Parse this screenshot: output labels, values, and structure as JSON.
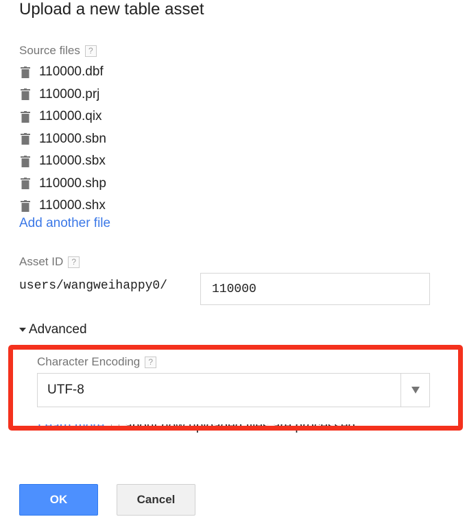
{
  "dialog": {
    "title": "Upload a new table asset"
  },
  "source_files": {
    "label": "Source files",
    "help": "?",
    "files": [
      "110000.dbf",
      "110000.prj",
      "110000.qix",
      "110000.sbn",
      "110000.sbx",
      "110000.shp",
      "110000.shx"
    ],
    "add_link": "Add another file"
  },
  "asset_id": {
    "label": "Asset ID",
    "help": "?",
    "prefix": "users/wangweihappy0/",
    "value": "110000"
  },
  "advanced": {
    "toggle_label": "Advanced",
    "encoding_label": "Character Encoding",
    "encoding_help": "?",
    "encoding_value": "UTF-8",
    "learn_more_link": "Learn more",
    "learn_more_text": "about how uploaded files are processed."
  },
  "buttons": {
    "ok": "OK",
    "cancel": "Cancel"
  },
  "colors": {
    "link": "#3b78e7",
    "primary": "#4d90fe",
    "highlight": "#f4311d"
  },
  "icons": {
    "file": "trash-icon",
    "help": "help-icon",
    "toggle": "caret-down-icon",
    "external": "external-link-icon",
    "dropdown": "dropdown-arrow-icon"
  }
}
